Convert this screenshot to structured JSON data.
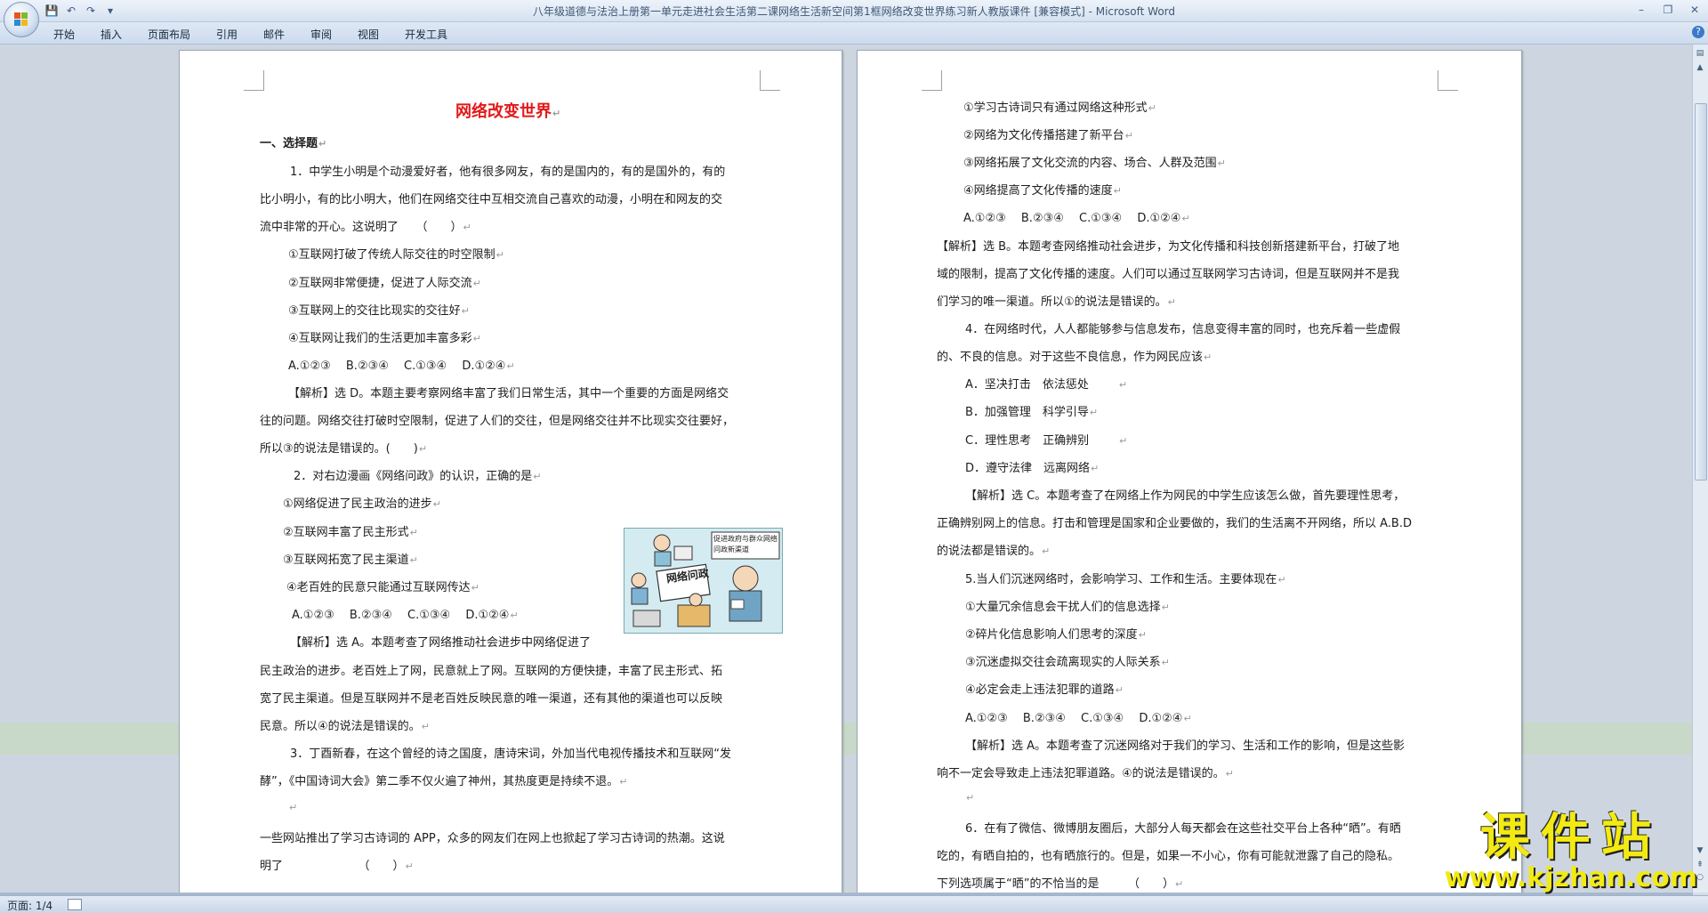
{
  "window": {
    "title": "八年级道德与法治上册第一单元走进社会生活第二课网络生活新空间第1框网络改变世界练习新人教版课件 [兼容模式] - Microsoft Word",
    "controls": [
      "–",
      "❐",
      "✕"
    ]
  },
  "qat": {
    "save_icon": "💾",
    "undo_icon": "↶",
    "redo_icon": "↷",
    "more_icon": "▾"
  },
  "ribbon": {
    "tabs": [
      "开始",
      "插入",
      "页面布局",
      "引用",
      "邮件",
      "审阅",
      "视图",
      "开发工具"
    ],
    "help": "?"
  },
  "page1": {
    "title": "网络改变世界",
    "section": "一、选择题",
    "lines": [
      "1．中学生小明是个动漫爱好者，他有很多网友，有的是国内的，有的是国外的，有的",
      "比小明小，有的比小明大，他们在网络交往中互相交流自己喜欢的动漫，小明在和网友的交",
      "流中非常的开心。这说明了　　（　　）",
      "①互联网打破了传统人际交往的时空限制",
      "②互联网非常便捷，促进了人际交流",
      "③互联网上的交往比现实的交往好",
      "④互联网让我们的生活更加丰富多彩",
      "A.①②③　 B.②③④　 C.①③④　 D.①②④",
      "【解析】选 D。本题主要考察网络丰富了我们日常生活，其中一个重要的方面是网络交",
      "往的问题。网络交往打破时空限制，促进了人们的交往，但是网络交往并不比现实交往要好，",
      "所以③的说法是错误的。(　　)",
      "2．对右边漫画《网络问政》的认识，正确的是",
      "①网络促进了民主政治的进步",
      "②互联网丰富了民主形式",
      "③互联网拓宽了民主渠道",
      "④老百姓的民意只能通过互联网传达",
      "A.①②③　 B.②③④　 C.①③④　 D.①②④",
      "【解析】选 A。本题考查了网络推动社会进步中网络促进了",
      "民主政治的进步。老百姓上了网，民意就上了网。互联网的方便快捷，丰富了民主形式、拓",
      "宽了民主渠道。但是互联网并不是老百姓反映民意的唯一渠道，还有其他的渠道也可以反映",
      "民意。所以④的说法是错误的。",
      "3．丁酉新春，在这个曾经的诗之国度，唐诗宋词，外加当代电视传播技术和互联网“发",
      "酵”，《中国诗词大会》第二季不仅火遍了神州，其热度更是持续不退。",
      "",
      "一些网站推出了学习古诗词的 APP，众多的网友们在网上也掀起了学习古诗词的热潮。这说",
      "明了　　　　　　　（　　）"
    ]
  },
  "cartoon": {
    "title": "网络问政",
    "note": "促进政府与群众网络问政新渠道"
  },
  "page2": {
    "lines": [
      "①学习古诗词只有通过网络这种形式",
      "②网络为文化传播搭建了新平台",
      "③网络拓展了文化交流的内容、场合、人群及范围",
      "④网络提高了文化传播的速度",
      "A.①②③　 B.②③④　 C.①③④　 D.①②④",
      "【解析】选 B。本题考查网络推动社会进步，为文化传播和科技创新搭建新平台，打破了地",
      "域的限制，提高了文化传播的速度。人们可以通过互联网学习古诗词，但是互联网并不是我",
      "们学习的唯一渠道。所以①的说法是错误的。",
      "4．在网络时代，人人都能够参与信息发布，信息变得丰富的同时，也充斥着一些虚假",
      "的、不良的信息。对于这些不良信息，作为网民应该",
      "A．坚决打击　依法惩处",
      "B．加强管理　科学引导",
      "C．理性思考　正确辨别",
      "D．遵守法律　远离网络",
      "【解析】选 C。本题考查了在网络上作为网民的中学生应该怎么做，首先要理性思考，",
      "正确辨别网上的信息。打击和管理是国家和企业要做的，我们的生活离不开网络，所以 A.B.D",
      "的说法都是错误的。",
      "5.当人们沉迷网络时，会影响学习、工作和生活。主要体现在",
      "①大量冗余信息会干扰人们的信息选择",
      "②碎片化信息影响人们思考的深度",
      "③沉迷虚拟交往会疏离现实的人际关系",
      "④必定会走上违法犯罪的道路",
      "A.①②③　 B.②③④　 C.①③④　 D.①②④",
      "【解析】选 A。本题考查了沉迷网络对于我们的学习、生活和工作的影响，但是这些影",
      "响不一定会导致走上违法犯罪道路。④的说法是错误的。",
      "",
      "6．在有了微信、微博朋友圈后，大部分人每天都会在这些社交平台上各种“晒”。有晒",
      "吃的，有晒自拍的，也有晒旅行的。但是，如果一不小心，你有可能就泄露了自己的隐私。",
      "下列选项属于“晒”的不恰当的是　　　（　　）"
    ]
  },
  "status": {
    "page": "页面: 1/4"
  },
  "watermark": {
    "main": "课件站",
    "url": "www.kjzhan.com"
  },
  "colors": {
    "heading": "#e2191a",
    "watermark": "#f2ea12"
  }
}
